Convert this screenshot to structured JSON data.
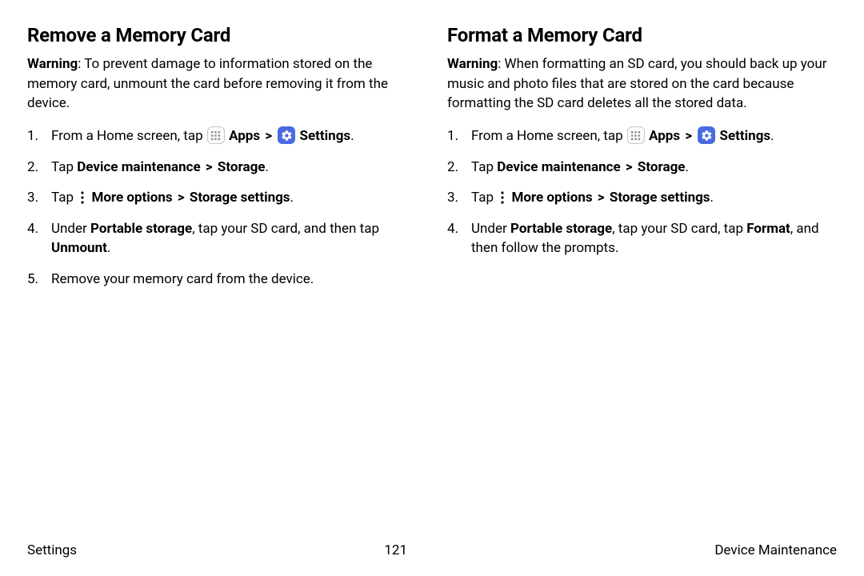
{
  "left": {
    "heading": "Remove a Memory Card",
    "warning_label": "Warning",
    "warning_text": ": To prevent damage to information stored on the memory card, unmount the card before removing it from the device.",
    "step1_pre": "From a Home screen, tap ",
    "apps_label": "Apps",
    "settings_label": "Settings",
    "step2_pre": "Tap ",
    "step2_b1": "Device maintenance",
    "step2_b2": "Storage",
    "step3_pre": "Tap ",
    "step3_b1": "More options",
    "step3_b2": "Storage settings",
    "step4_pre": "Under ",
    "step4_b1": "Portable storage",
    "step4_mid": ", tap your SD card, and then tap ",
    "step4_b2": "Unmount",
    "step5": "Remove your memory card from the device."
  },
  "right": {
    "heading": "Format a Memory Card",
    "warning_label": "Warning",
    "warning_text": ": When formatting an SD card, you should back up your music and photo files that are stored on the card because formatting the SD card deletes all the stored data.",
    "step1_pre": "From a Home screen, tap ",
    "apps_label": "Apps",
    "settings_label": "Settings",
    "step2_pre": "Tap ",
    "step2_b1": "Device maintenance",
    "step2_b2": "Storage",
    "step3_pre": "Tap ",
    "step3_b1": "More options",
    "step3_b2": "Storage settings",
    "step4_pre": "Under ",
    "step4_b1": "Portable storage",
    "step4_mid": ", tap your SD card, tap ",
    "step4_b2": "Format",
    "step4_post": ", and then follow the prompts."
  },
  "chevron": ">",
  "period": ".",
  "footer": {
    "left": "Settings",
    "center": "121",
    "right": "Device Maintenance"
  }
}
